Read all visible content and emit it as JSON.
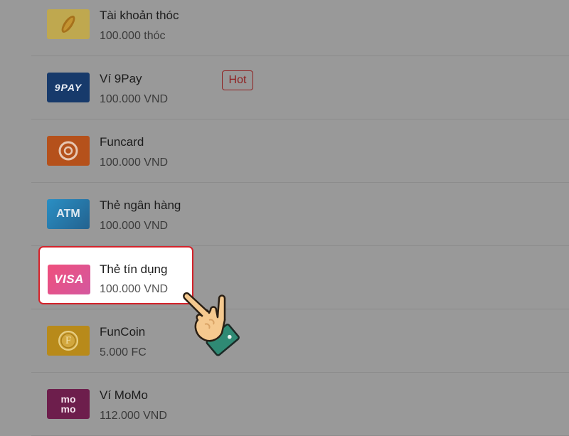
{
  "payment_methods": [
    {
      "name": "Tài khoản thóc",
      "price": "100.000 thóc",
      "icon": "rice-grain-icon",
      "color": "#b8a24a"
    },
    {
      "name": "Ví 9Pay",
      "price": "100.000 VND",
      "icon": "9pay-logo-icon",
      "logo_text": "9PAY",
      "color": "#173a6b",
      "badge": "Hot"
    },
    {
      "name": "Funcard",
      "price": "100.000 VND",
      "icon": "funcard-swirl-icon",
      "color": "#b5511b"
    },
    {
      "name": "Thẻ ngân hàng",
      "price": "100.000 VND",
      "icon": "atm-card-icon",
      "logo_text": "ATM",
      "color": "#2d7db0"
    },
    {
      "name": "Thẻ tín dụng",
      "price": "100.000 VND",
      "icon": "visa-card-icon",
      "logo_text": "VISA",
      "color": "#e8568a",
      "highlighted": true
    },
    {
      "name": "FunCoin",
      "price": "5.000 FC",
      "icon": "funcoin-icon",
      "logo_text": "F",
      "color": "#b88a1a"
    },
    {
      "name": "Ví MoMo",
      "price": "112.000 VND",
      "icon": "momo-logo-icon",
      "logo_text": "mo mo",
      "color": "#6d1e4c"
    }
  ],
  "pointer": {
    "icon": "pointing-hand-icon"
  }
}
